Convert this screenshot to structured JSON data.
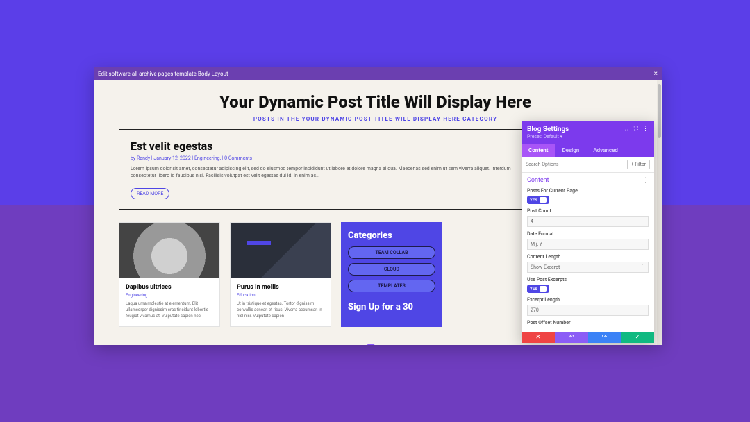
{
  "titlebar": {
    "text": "Edit software all archive pages template Body Layout"
  },
  "page": {
    "title": "Your Dynamic Post Title Will Display Here",
    "subheading": "POSTS IN THE YOUR DYNAMIC POST TITLE WILL DISPLAY HERE CATEGORY"
  },
  "featured": {
    "title": "Est velit egestas",
    "meta": "by Randy | January 12, 2022 | Engineering, | 0 Comments",
    "excerpt": "Lorem ipsum dolor sit amet, consectetur adipiscing elit, sed do eiusmod tempor incididunt ut labore et dolore magna aliqua. Maecenas sed enim ut sem viverra aliquet. Interdum consectetur libero id faucibus nisl. Facilisis volutpat est velit egestas dui id. In enim ac...",
    "readmore": "READ MORE"
  },
  "cards": [
    {
      "title": "Dapibus ultrices",
      "category": "Engineering",
      "excerpt": "Laqua urna molestie at elementum. Elit ullamcorper dignissim cras tincidunt lobortis feugiat vivamus at. Vulputate sapien nec"
    },
    {
      "title": "Purus in mollis",
      "category": "Education",
      "excerpt": "Ut in tristique et egestas. Tortor dignissim convallis aenean et risus. Viverra accumsan in nisl nisi. Vulputate sapien"
    }
  ],
  "sidebar": {
    "heading": "Categories",
    "pills": [
      "TEAM COLLAB",
      "CLOUD",
      "TEMPLATES"
    ],
    "signup": "Sign Up for a 30"
  },
  "panel": {
    "title": "Blog Settings",
    "preset": "Preset: Default ▾",
    "tabs": [
      "Content",
      "Design",
      "Advanced"
    ],
    "search_placeholder": "Search Options",
    "filter_label": "+ Filter",
    "section_title": "Content",
    "fields": {
      "posts_current_page_label": "Posts For Current Page",
      "posts_current_page_toggle": "YES",
      "post_count_label": "Post Count",
      "post_count_value": "4",
      "date_format_label": "Date Format",
      "date_format_value": "M j, Y",
      "content_length_label": "Content Length",
      "content_length_value": "Show Excerpt",
      "use_excerpts_label": "Use Post Excerpts",
      "use_excerpts_toggle": "YES",
      "excerpt_length_label": "Excerpt Length",
      "excerpt_length_value": "270",
      "post_offset_label": "Post Offset Number"
    }
  }
}
